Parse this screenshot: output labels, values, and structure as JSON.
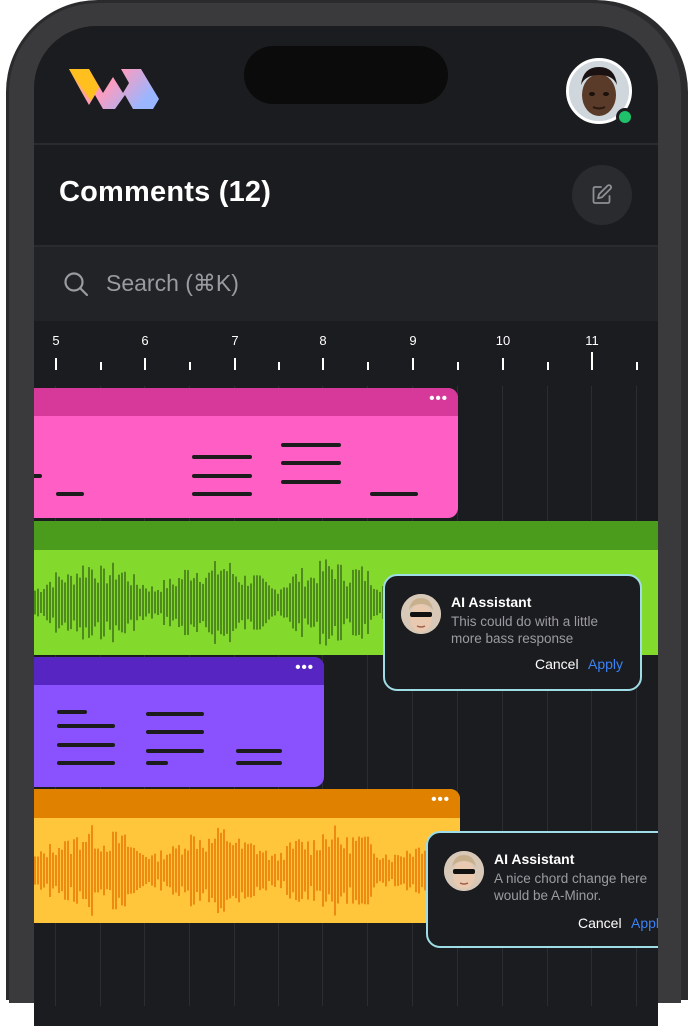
{
  "header": {
    "logo": "wm-logo",
    "avatar_status": "online",
    "status_color": "#1fc16b"
  },
  "page": {
    "title": "Comments (12)",
    "edit_icon": "pencil-square-icon"
  },
  "search": {
    "placeholder": "Search (⌘K)",
    "icon": "search-icon"
  },
  "timeline": {
    "ruler_labels": [
      "5",
      "6",
      "7",
      "8",
      "9",
      "10",
      "11"
    ]
  },
  "tracks": [
    {
      "type": "midi",
      "color": "#ff5ec4",
      "header_color": "#d6399a",
      "menu": "•••"
    },
    {
      "type": "audio",
      "color": "#84d92d",
      "header_color": "#4b9b1d"
    },
    {
      "type": "midi",
      "color": "#8a52ff",
      "header_color": "#5625c2",
      "menu": "•••"
    },
    {
      "type": "audio",
      "color": "#ffc53b",
      "header_color": "#e08200",
      "menu": "•••"
    }
  ],
  "comments": [
    {
      "author": "AI Assistant",
      "text": "This could do with a little more bass response",
      "cancel": "Cancel",
      "apply": "Apply"
    },
    {
      "author": "AI Assistant",
      "text": "A nice chord change here would be A-Minor.",
      "cancel": "Cancel",
      "apply": "Apply"
    }
  ],
  "colors": {
    "background": "#1b1c1f",
    "accent_link": "#3b82f6",
    "comment_border": "#9fdde6"
  }
}
